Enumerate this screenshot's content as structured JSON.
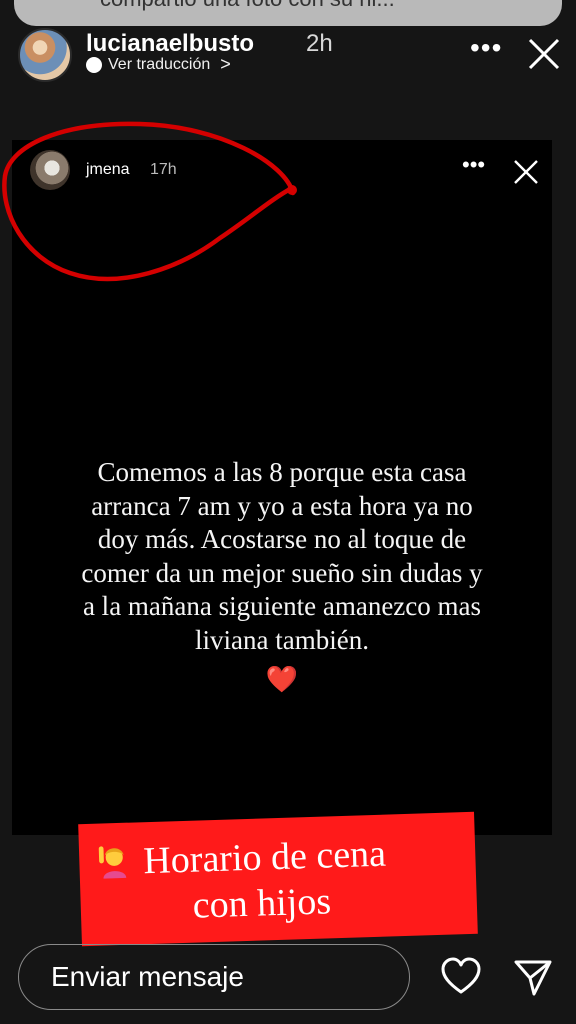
{
  "top_banner": {
    "text": "compartió una foto con su hi..."
  },
  "outer_story": {
    "username": "lucianaelbusto",
    "time": "2h",
    "translate_label": "Ver traducción",
    "translate_chevron": ">",
    "more_icon": "more-dots-icon",
    "close_icon": "close-icon"
  },
  "inner_story": {
    "username": "jmena",
    "time": "17h",
    "more_icon": "more-dots-icon",
    "close_icon": "close-icon",
    "body_text": "Comemos a las 8 porque esta casa arranca 7 am y yo a esta hora ya no doy más. Acostarse no al toque de comer da un mejor sueño sin dudas y a la mañana siguiente amanezco mas liviana también.",
    "heart": "❤️"
  },
  "sticker": {
    "line1": "Horario de cena",
    "line2": "con hijos",
    "emoji_icon": "person-raising-hand-icon",
    "color": "#ff1a1a"
  },
  "annotation": {
    "color": "#d40000",
    "shape": "hand-drawn-red-circle"
  },
  "footer": {
    "message_placeholder": "Enviar mensaje",
    "like_icon": "heart-outline-icon",
    "send_icon": "send-paper-plane-icon"
  }
}
